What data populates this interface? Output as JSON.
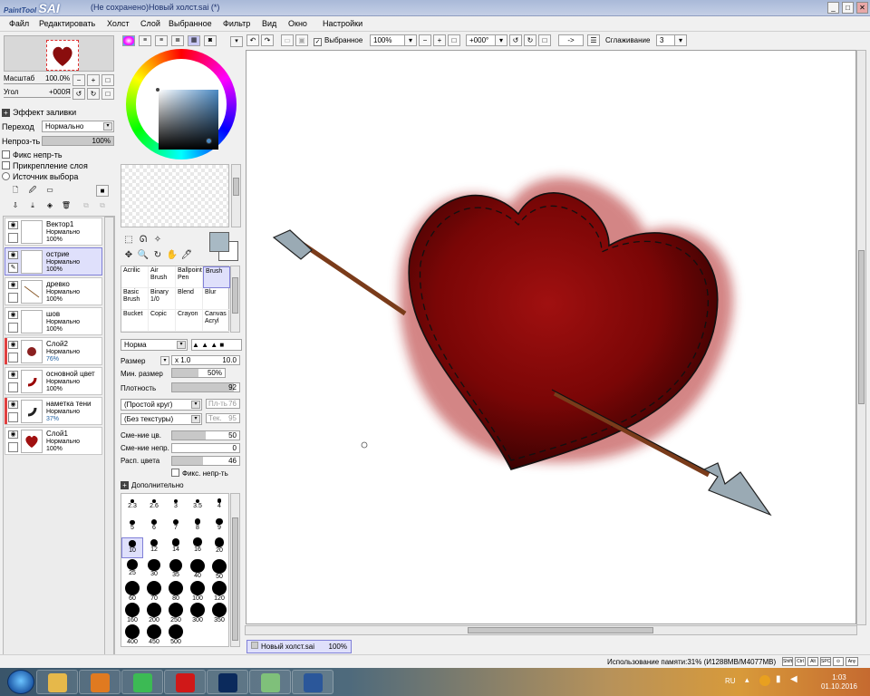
{
  "app": {
    "logo_small": "PaintTool",
    "logo_big": "SAI",
    "window_title": "(Не сохранено)Новый холст.sai (*)",
    "win_buttons": [
      "_",
      "□",
      "✕"
    ]
  },
  "menu": [
    "Файл",
    "Редактировать",
    "Холст",
    "Слой",
    "Выбранное",
    "Фильтр",
    "Вид",
    "Окно",
    "Настройки"
  ],
  "toolbar": {
    "selection_label": "Выбранное",
    "zoom": "100%",
    "rotation": "+000°",
    "flip": "->",
    "smoothing_label": "Сглаживание",
    "smoothing_value": "3"
  },
  "navigator": {
    "zoom_label": "Масштаб",
    "zoom_value": "100.0%",
    "angle_label": "Угол",
    "angle_value": "+000Я"
  },
  "layer_props": {
    "fill_effect": "Эффект заливки",
    "blend_label": "Переход",
    "blend_value": "Нормально",
    "opacity_label": "Непроз-ть",
    "opacity_value": "100%",
    "opacity_level": 1.0,
    "preserve_opacity": "Фикс непр-ть",
    "clipping": "Прикрепление слоя",
    "selection_source": "Источник выбора"
  },
  "layers": [
    {
      "name": "Вектор1",
      "mode": "Нормально",
      "opacity": "100%",
      "thumb": "vector",
      "selected": false,
      "marked": false
    },
    {
      "name": "острие",
      "mode": "Нормально",
      "opacity": "100%",
      "thumb": "blank",
      "selected": true,
      "marked": false
    },
    {
      "name": "древко",
      "mode": "Нормально",
      "opacity": "100%",
      "thumb": "line",
      "selected": false,
      "marked": false
    },
    {
      "name": "шов",
      "mode": "Нормально",
      "opacity": "100%",
      "thumb": "blank",
      "selected": false,
      "marked": false
    },
    {
      "name": "Слой2",
      "mode": "Нормально",
      "opacity": "76%",
      "thumb": "blob",
      "selected": false,
      "marked": true
    },
    {
      "name": "основной цвет",
      "mode": "Нормально",
      "opacity": "100%",
      "thumb": "stroke",
      "selected": false,
      "marked": false
    },
    {
      "name": "наметка тени",
      "mode": "Нормально",
      "opacity": "37%",
      "thumb": "stroke",
      "selected": false,
      "marked": true
    },
    {
      "name": "Слой1",
      "mode": "Нормально",
      "opacity": "100%",
      "thumb": "heart",
      "selected": false,
      "marked": false
    }
  ],
  "color": {
    "foreground": "#a8b9c4",
    "background": "#ffffff"
  },
  "brushes": [
    {
      "line1": "Acrilic",
      "line2": ""
    },
    {
      "line1": "Air",
      "line2": "Brush"
    },
    {
      "line1": "Ballpoint",
      "line2": "Pen"
    },
    {
      "line1": "Brush",
      "line2": ""
    },
    {
      "line1": "Basic",
      "line2": "Brush"
    },
    {
      "line1": "Binary",
      "line2": "1/0"
    },
    {
      "line1": "Blend",
      "line2": ""
    },
    {
      "line1": "Blur",
      "line2": ""
    },
    {
      "line1": "Bucket",
      "line2": ""
    },
    {
      "line1": "Copic",
      "line2": ""
    },
    {
      "line1": "Crayon",
      "line2": ""
    },
    {
      "line1": "Canvas",
      "line2": "Acryl"
    }
  ],
  "brush_settings": {
    "mode": "Норма",
    "size_label": "Размер",
    "size_mult": "x 1.0",
    "size_value": "10.0",
    "min_size_label": "Мин. размер",
    "min_size_value": "50%",
    "min_size_level": 0.5,
    "density_label": "Плотность",
    "density_value": "92",
    "density_level": 0.92,
    "shape": "(Простой круг)",
    "shape_strength": "Пл-ть",
    "shape_strength_value": "76",
    "texture": "(Без текстуры)",
    "texture_strength": "Тек.",
    "texture_strength_value": "95",
    "blend_label": "Сме-ние цв.",
    "blend_value": "50",
    "blend_level": 0.5,
    "dilution_label": "Сме-ние непр.",
    "dilution_value": "0",
    "dilution_level": 0.0,
    "persistence_label": "Расп. цвета",
    "persistence_value": "46",
    "persistence_level": 0.46,
    "keep_opacity": "Фикс. непр-ть",
    "advanced": "Дополнительно"
  },
  "brush_sizes": [
    "2.3",
    "2.6",
    "3",
    "3.5",
    "4",
    "5",
    "6",
    "7",
    "8",
    "9",
    "10",
    "12",
    "14",
    "16",
    "20",
    "25",
    "30",
    "35",
    "40",
    "50",
    "60",
    "70",
    "80",
    "100",
    "120",
    "160",
    "200",
    "250",
    "300",
    "350",
    "400",
    "450",
    "500"
  ],
  "selected_size": "10",
  "doc_tab": {
    "name": "Новый холст.sai",
    "zoom": "100%"
  },
  "status": {
    "memory": "Использование памяти:31% (И1288MB/M4077MB)",
    "keys": [
      "Shift",
      "Ctrl",
      "Alt",
      "SPC",
      "⊙",
      "Any"
    ]
  },
  "taskbar": {
    "apps": [
      {
        "name": "explorer",
        "color": "#e6b84a"
      },
      {
        "name": "media",
        "color": "#e07a20"
      },
      {
        "name": "chrome",
        "color": "#3cba54"
      },
      {
        "name": "opera",
        "color": "#d01818"
      },
      {
        "name": "photoshop",
        "color": "#0b2a5c"
      },
      {
        "name": "sai",
        "color": "#7fc07a"
      },
      {
        "name": "word",
        "color": "#2b579a"
      }
    ],
    "lang": "RU",
    "time": "1:03",
    "date": "01.10.2016"
  }
}
